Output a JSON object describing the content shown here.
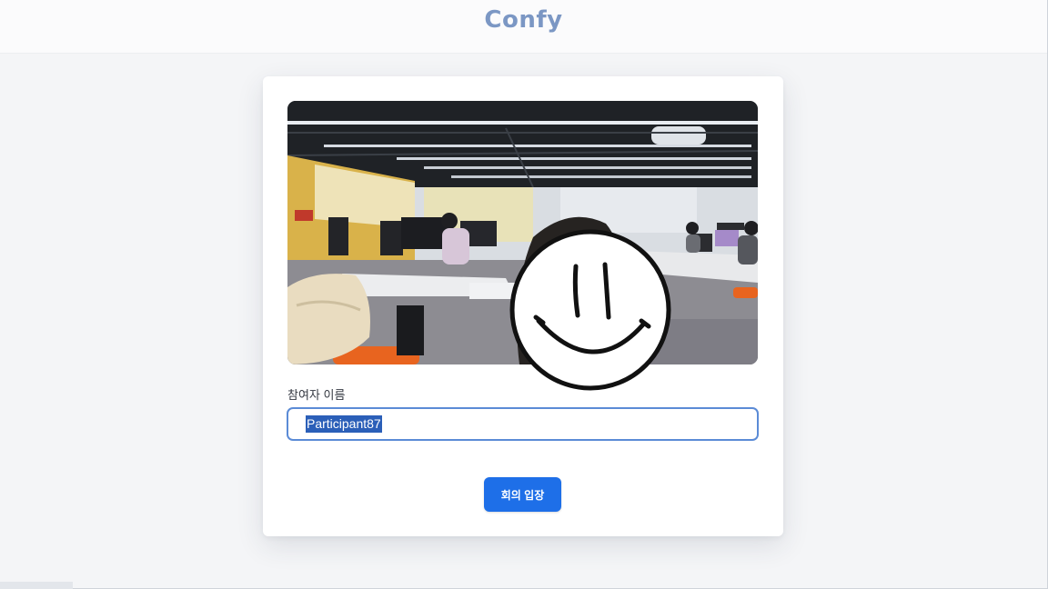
{
  "header": {
    "brand": "Confy"
  },
  "preview": {
    "description_icon": "camera-preview",
    "overlay_icon": "smiley-face-icon"
  },
  "form": {
    "name_label": "참여자 이름",
    "name_value": "Participant87"
  },
  "actions": {
    "join_label": "회의 입장"
  },
  "colors": {
    "brand": "#7b97c4",
    "button": "#1e6fe8",
    "input_border": "#5b8bd6",
    "selection": "#2b5fb8"
  }
}
